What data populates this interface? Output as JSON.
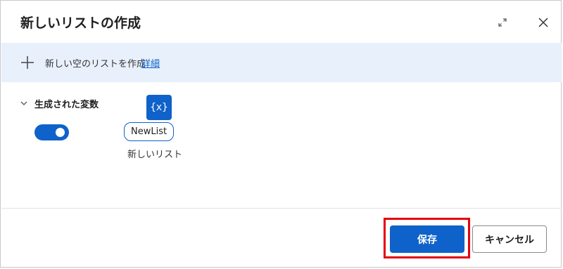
{
  "dialog": {
    "title": "新しいリストの作成",
    "expand_icon": "expand-icon",
    "close_icon": "close-icon"
  },
  "banner": {
    "icon": "plus-icon",
    "text": "新しい空のリストを作成",
    "link_label": "詳細"
  },
  "variables_section": {
    "chevron_icon": "chevron-down-icon",
    "title": "生成された変数",
    "toggle_on": true,
    "variable_icon_label": "{x}",
    "variable_name": "NewList",
    "variable_description": "新しいリスト"
  },
  "footer": {
    "save_label": "保存",
    "cancel_label": "キャンセル"
  },
  "colors": {
    "accent": "#0f62c9",
    "banner_bg": "#e8f0fb",
    "highlight": "#e3000b"
  }
}
